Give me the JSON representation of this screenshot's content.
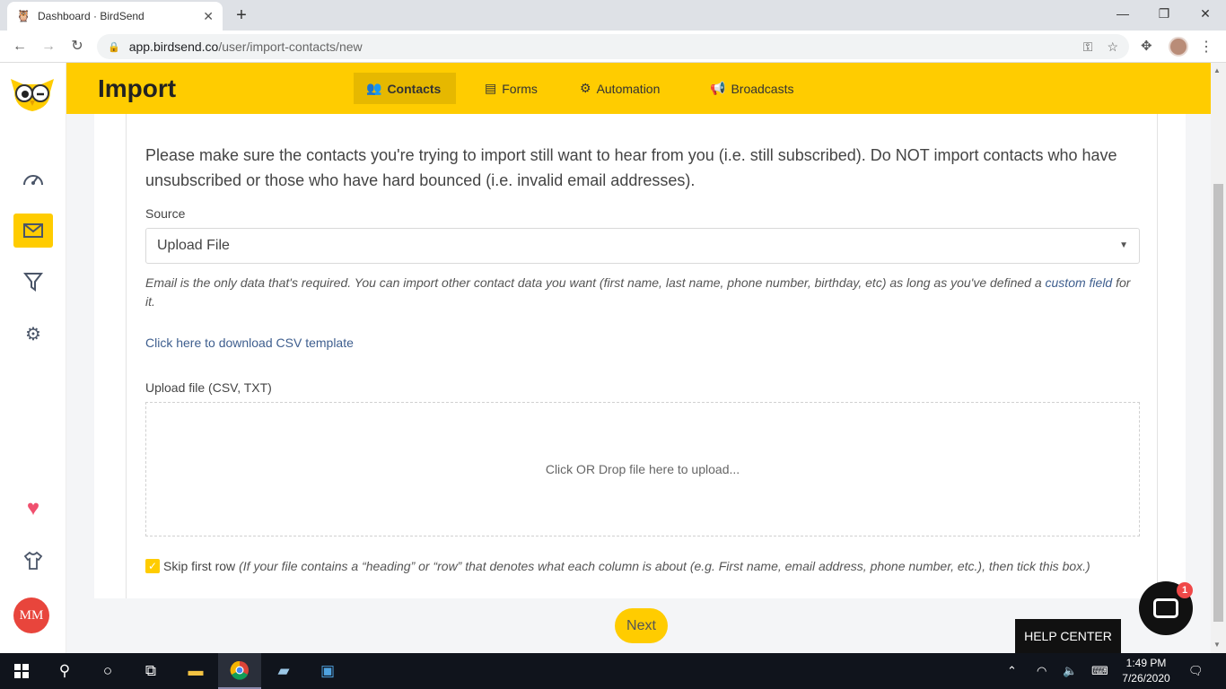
{
  "browser": {
    "tab_title": "Dashboard · BirdSend",
    "url_host": "app.birdsend.co",
    "url_path": "/user/import-contacts/new"
  },
  "header": {
    "title": "Import",
    "nav": [
      {
        "label": "Contacts",
        "icon": "users-icon",
        "active": true
      },
      {
        "label": "Forms",
        "icon": "form-icon",
        "active": false
      },
      {
        "label": "Automation",
        "icon": "cogs-icon",
        "active": false
      },
      {
        "label": "Broadcasts",
        "icon": "megaphone-icon",
        "active": false
      }
    ]
  },
  "sidebar": {
    "items": [
      "gauge-icon",
      "mail-icon",
      "filter-icon",
      "settings-icon",
      "heart-icon",
      "shirt-icon"
    ],
    "avatar_initials": "MM"
  },
  "main": {
    "intro": "Please make sure the contacts you're trying to import still want to hear from you (i.e. still subscribed). Do NOT import contacts who have unsubscribed or those who have hard bounced (i.e. invalid email addresses).",
    "source_label": "Source",
    "source_value": "Upload File",
    "hint_before": "Email is the only data that's required. You can import other contact data you want (first name, last name, phone number, birthday, etc) as long as you've defined a ",
    "hint_link": "custom field",
    "hint_after": " for it.",
    "csv_link": "Click here to download CSV template",
    "upload_label": "Upload file (CSV, TXT)",
    "dropzone_text": "Click OR Drop file here to upload...",
    "skip_label": "Skip first row",
    "skip_note": "(If your file contains a “heading” or “row” that denotes what each column is about (e.g. First name, email address, phone number, etc.), then tick this box.)",
    "skip_checked": true,
    "next_button": "Next"
  },
  "widgets": {
    "help_center": "HELP CENTER",
    "chat_badge": "1"
  },
  "taskbar": {
    "time": "1:49 PM",
    "date": "7/26/2020"
  },
  "colors": {
    "brand_yellow": "#ffcc00",
    "link_blue": "#3e5e8e",
    "avatar_red": "#e8453c"
  }
}
